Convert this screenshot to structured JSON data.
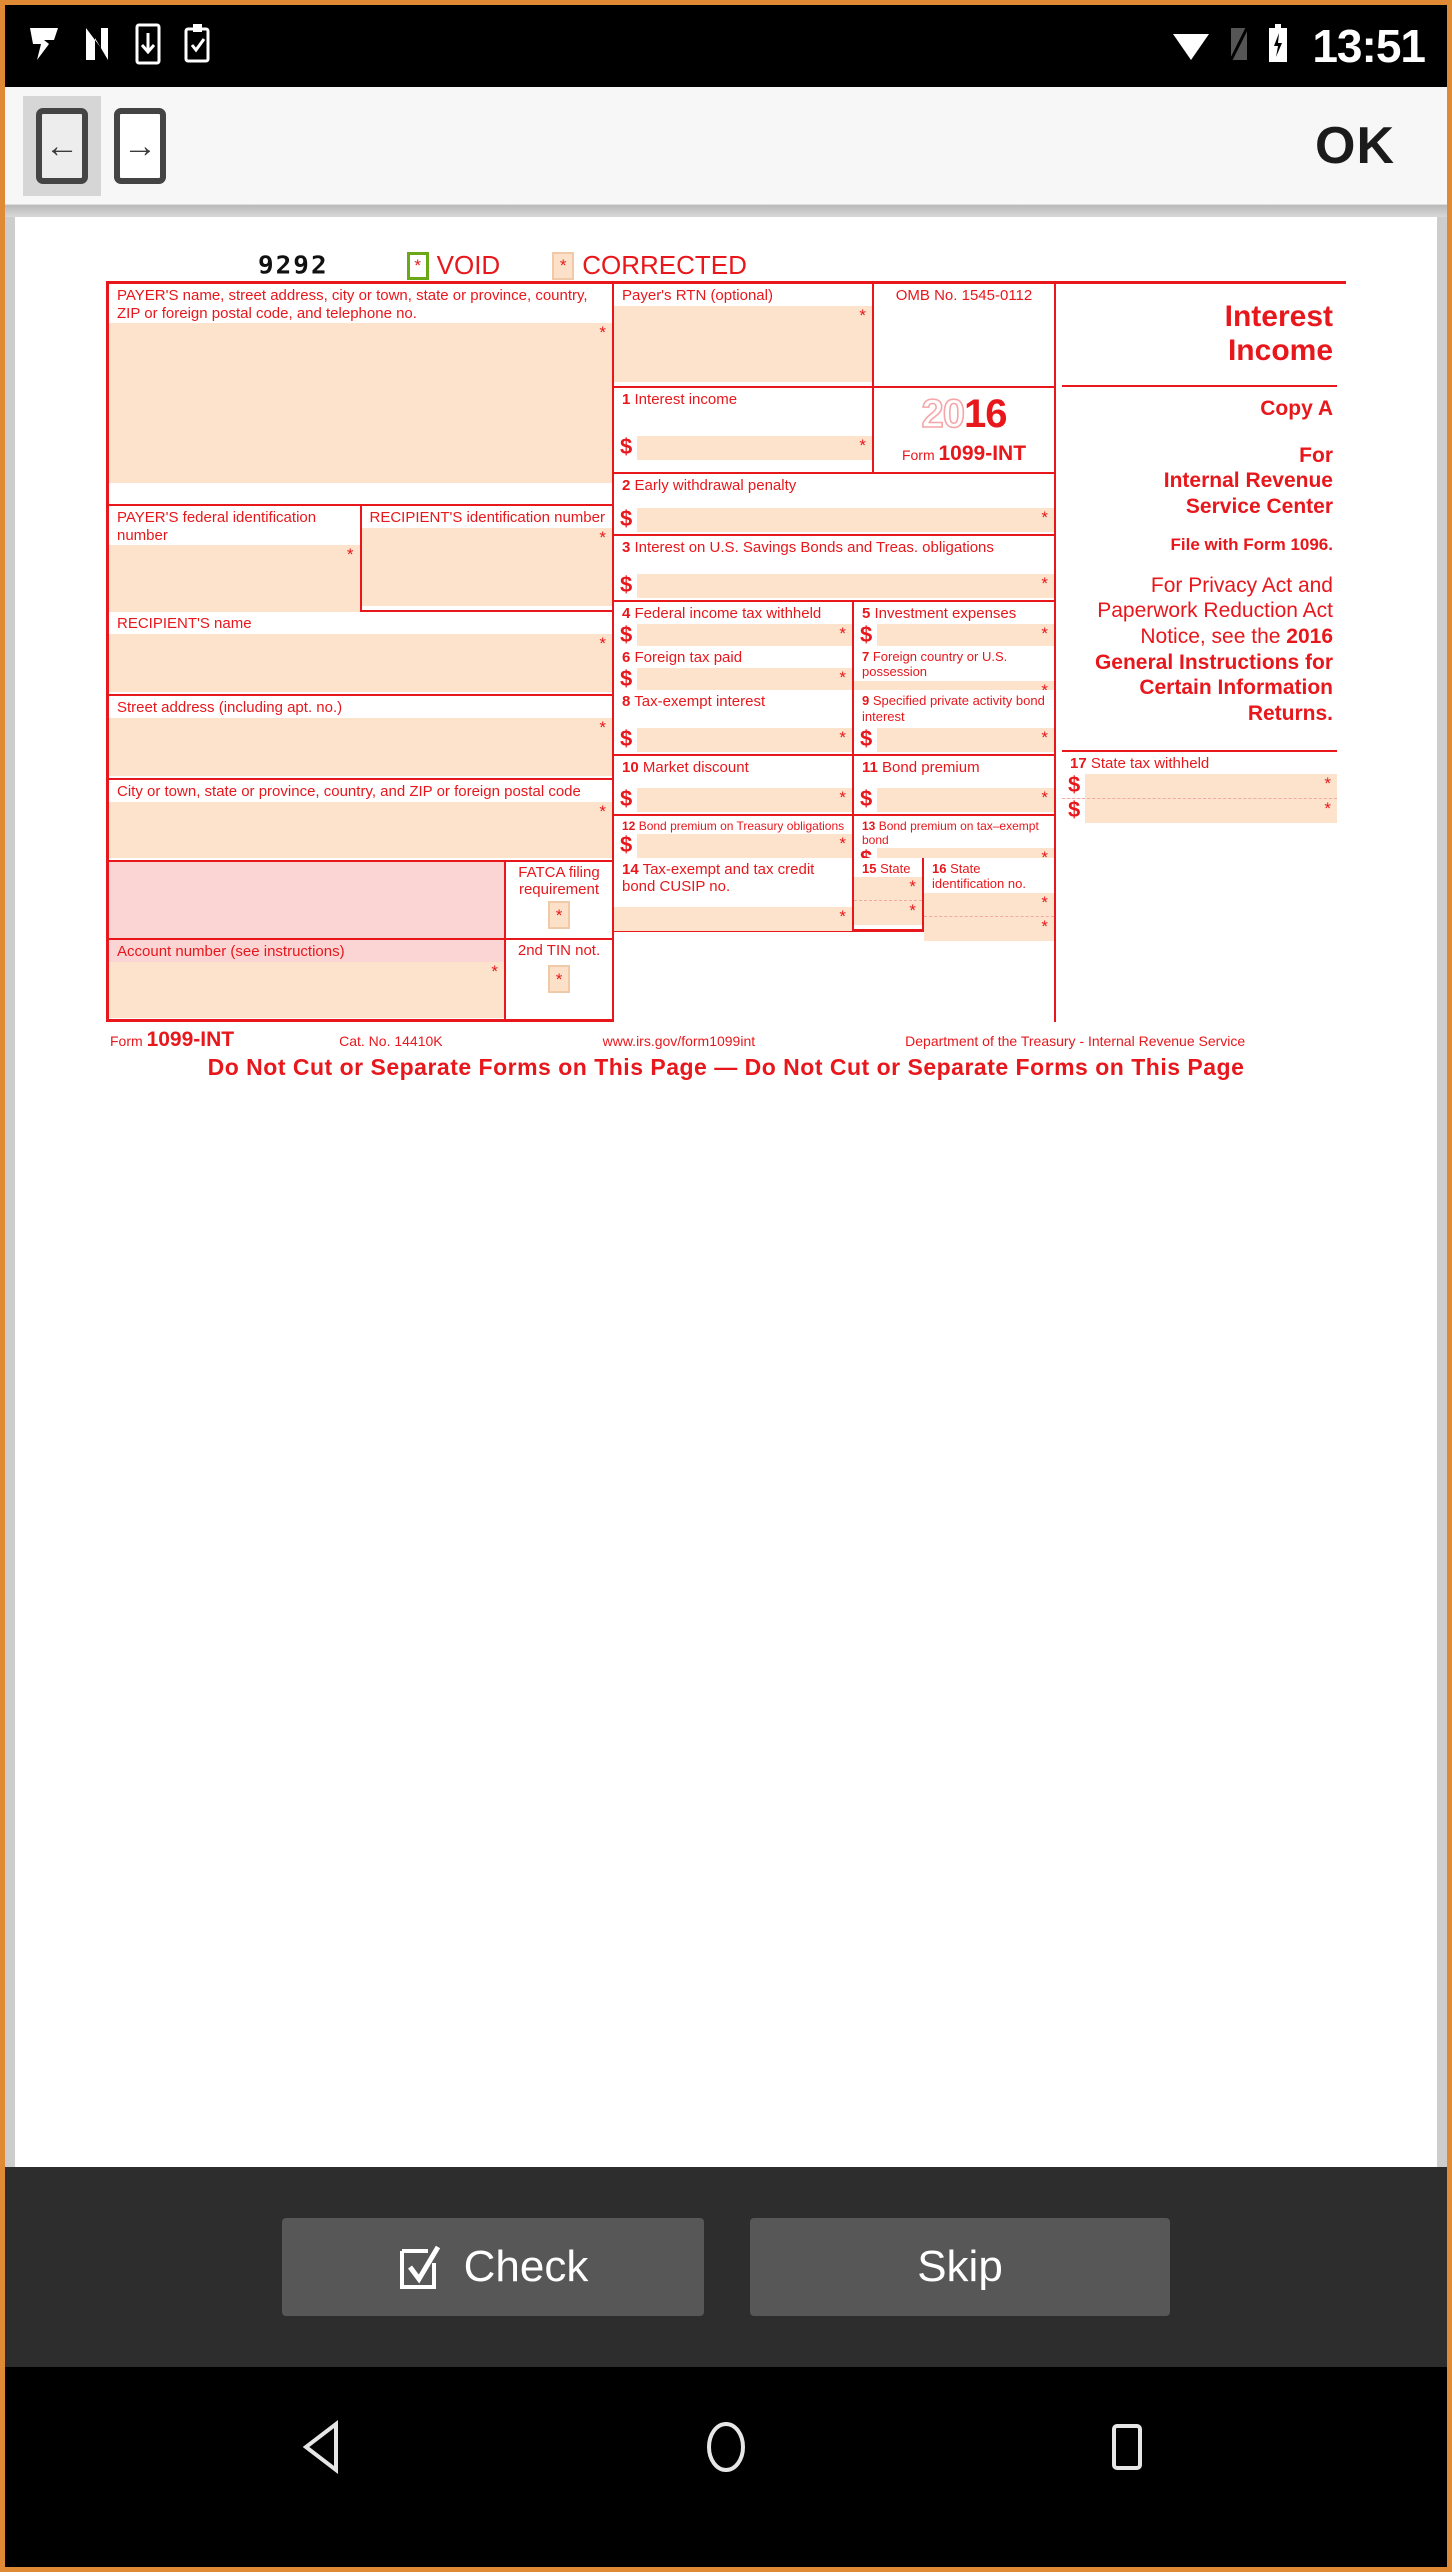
{
  "statusbar": {
    "time": "13:51",
    "left_icons": [
      "app-icon-v",
      "app-icon-n",
      "download-icon",
      "clipboard-check-icon"
    ],
    "right_icons": [
      "wifi-icon",
      "signal-off-icon",
      "battery-charging-icon"
    ]
  },
  "toolbar": {
    "back_label": "←",
    "forward_label": "→",
    "ok_label": "OK"
  },
  "form": {
    "form_number_code": "9292",
    "void_label": "VOID",
    "corrected_label": "CORRECTED",
    "checkbox_mark": "*",
    "payer_name_label": "PAYER'S name, street address, city or town, state or province, country, ZIP or foreign postal code, and telephone no.",
    "payer_rtn_label": "Payer's RTN (optional)",
    "omb_label": "OMB No. 1545-0112",
    "year_light": "20",
    "year_bold": "16",
    "form_word": "Form",
    "form_name": "1099-INT",
    "payer_tin_label": "PAYER'S federal identification number",
    "recipient_tin_label": "RECIPIENT'S identification number",
    "recipient_name_label": "RECIPIENT'S name",
    "street_label": "Street address (including apt. no.)",
    "city_label": "City or town, state or province, country, and ZIP or foreign postal code",
    "fatca_label_line1": "FATCA filing",
    "fatca_label_line2": "requirement",
    "account_label": "Account number (see instructions)",
    "tin_not_label": "2nd TIN not.",
    "dollar": "$",
    "boxes": {
      "b1": {
        "num": "1",
        "label": "Interest income"
      },
      "b2": {
        "num": "2",
        "label": "Early withdrawal penalty"
      },
      "b3": {
        "num": "3",
        "label": "Interest on U.S. Savings Bonds and Treas. obligations"
      },
      "b4": {
        "num": "4",
        "label": "Federal income tax withheld"
      },
      "b5": {
        "num": "5",
        "label": "Investment expenses"
      },
      "b6": {
        "num": "6",
        "label": "Foreign tax paid"
      },
      "b7": {
        "num": "7",
        "label": "Foreign country or U.S. possession"
      },
      "b8": {
        "num": "8",
        "label": "Tax-exempt interest"
      },
      "b9": {
        "num": "9",
        "label": "Specified private activity bond interest"
      },
      "b10": {
        "num": "10",
        "label": "Market discount"
      },
      "b11": {
        "num": "11",
        "label": "Bond premium"
      },
      "b12": {
        "num": "12",
        "label": "Bond premium on Treasury obligations"
      },
      "b13": {
        "num": "13",
        "label": "Bond premium on tax–exempt bond"
      },
      "b14": {
        "num": "14",
        "label": "Tax-exempt and tax credit bond CUSIP no."
      },
      "b15": {
        "num": "15",
        "label": "State"
      },
      "b16": {
        "num": "16",
        "label": "State identification no."
      },
      "b17": {
        "num": "17",
        "label": "State tax withheld"
      }
    },
    "right": {
      "title_line1": "Interest",
      "title_line2": "Income",
      "copy": "Copy A",
      "for_line1": "For",
      "for_line2": "Internal Revenue",
      "for_line3": "Service Center",
      "file_with": "File with Form 1096.",
      "privacy_plain": "For Privacy Act and Paperwork Reduction Act Notice, see the ",
      "privacy_bold": "2016 General Instructions for Certain Information Returns."
    },
    "footer": {
      "form_word": "Form",
      "form_name": "1099-INT",
      "cat_no": "Cat. No. 14410K",
      "url": "www.irs.gov/form1099int",
      "dept": "Department of the Treasury - Internal Revenue Service",
      "do_not_cut": "Do Not Cut or Separate Forms on This Page  —  Do Not Cut or Separate Forms on This Page"
    }
  },
  "bottom": {
    "check_label": "Check",
    "skip_label": "Skip"
  },
  "navbar": {
    "back": "back-triangle-icon",
    "home": "home-circle-icon",
    "recents": "recents-square-icon"
  }
}
